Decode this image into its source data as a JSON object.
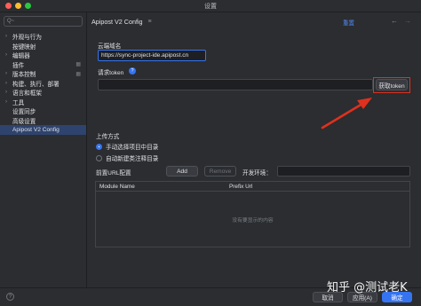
{
  "window": {
    "title": "设置"
  },
  "sidebar": {
    "search_placeholder": "Q~",
    "items": [
      {
        "label": "外观与行为",
        "arrow": true
      },
      {
        "label": "按键映射",
        "arrow": false
      },
      {
        "label": "编辑器",
        "arrow": true
      },
      {
        "label": "插件",
        "arrow": false,
        "gear": true
      },
      {
        "label": "版本控制",
        "arrow": true,
        "gear": true
      },
      {
        "label": "构建、执行、部署",
        "arrow": true
      },
      {
        "label": "语言和框架",
        "arrow": true
      },
      {
        "label": "工具",
        "arrow": true
      },
      {
        "label": "设置同步",
        "arrow": false
      },
      {
        "label": "高级设置",
        "arrow": false
      },
      {
        "label": "Apipost V2 Config",
        "arrow": false,
        "selected": true
      }
    ]
  },
  "header": {
    "title": "Apipost V2 Config",
    "reset": "重置"
  },
  "form": {
    "cloud_domain_label": "云端域名",
    "cloud_domain_value": "https://sync-project-ide.apipost.cn",
    "token_label": "请求token",
    "token_value": "",
    "get_token_button": "获取token",
    "upload_label": "上传方式",
    "upload_options": [
      "手动选择项目中目录",
      "自动新建类注释目录"
    ],
    "prefix_label": "前置URL配置",
    "add_button": "Add",
    "remove_button": "Remove",
    "env_label": "开发环境：",
    "env_value": ""
  },
  "table": {
    "columns": [
      "Module Name",
      "Prefix Url"
    ],
    "empty_text": "没有要显示的内容"
  },
  "footer": {
    "cancel": "取消",
    "apply": "应用(A)",
    "ok": "确定"
  },
  "watermark": "知乎 @测试老K",
  "colors": {
    "accent": "#3574f0",
    "annotation": "#e0301e"
  }
}
